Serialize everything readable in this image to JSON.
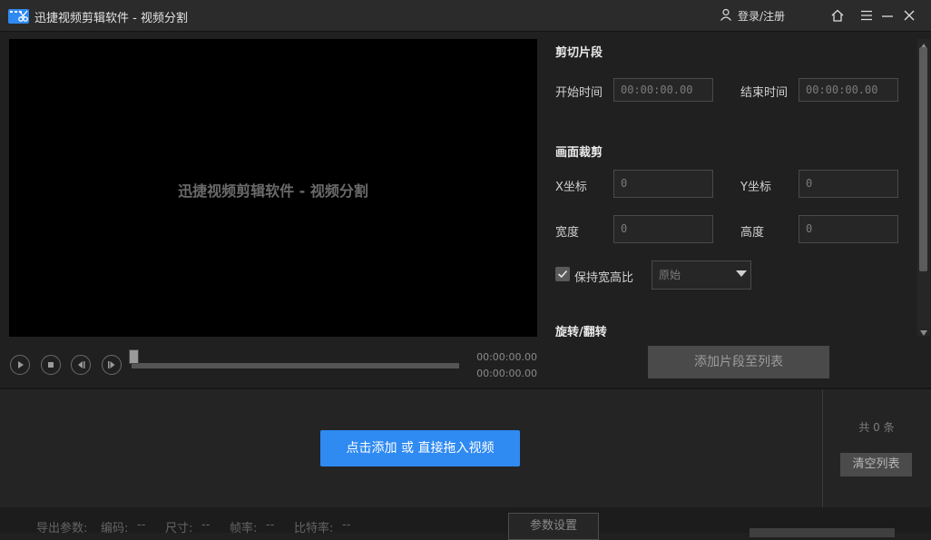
{
  "window": {
    "title": "迅捷视频剪辑软件 - 视频分割",
    "login_label": "登录/注册",
    "icons": [
      "app-logo-icon",
      "user-icon",
      "home-icon",
      "menu-icon",
      "minimize-icon",
      "close-icon"
    ]
  },
  "preview": {
    "watermark": "迅捷视频剪辑软件 - 视频分割",
    "time_current": "00:00:00.00",
    "time_total": "00:00:00.00",
    "controls": [
      "play-icon",
      "stop-icon",
      "previous-frame-icon",
      "next-frame-icon"
    ]
  },
  "clip_segment": {
    "title": "剪切片段",
    "start_label": "开始时间",
    "start_value": "00:00:00.00",
    "end_label": "结束时间",
    "end_value": "00:00:00.00"
  },
  "crop": {
    "title": "画面裁剪",
    "x_label": "X坐标",
    "x_value": "0",
    "y_label": "Y坐标",
    "y_value": "0",
    "width_label": "宽度",
    "width_value": "0",
    "height_label": "高度",
    "height_value": "0",
    "keep_ratio_label": "保持宽高比",
    "keep_ratio_checked": true,
    "ratio_value": "原始"
  },
  "rotate": {
    "title": "旋转/翻转"
  },
  "add_segment_label": "添加片段至列表",
  "list": {
    "add_video_label": "点击添加 或 直接拖入视频",
    "count_text": "共 0 条",
    "clear_label": "清空列表"
  },
  "export": {
    "params_label": "导出参数:",
    "codec_label": "编码:",
    "codec_value": "--",
    "size_label": "尺寸:",
    "size_value": "--",
    "fps_label": "帧率:",
    "fps_value": "--",
    "bitrate_label": "比特率:",
    "bitrate_value": "--",
    "settings_label": "参数设置"
  },
  "colors": {
    "accent": "#2f8af2",
    "background": "#202020",
    "titlebar": "#2b2b2b"
  }
}
